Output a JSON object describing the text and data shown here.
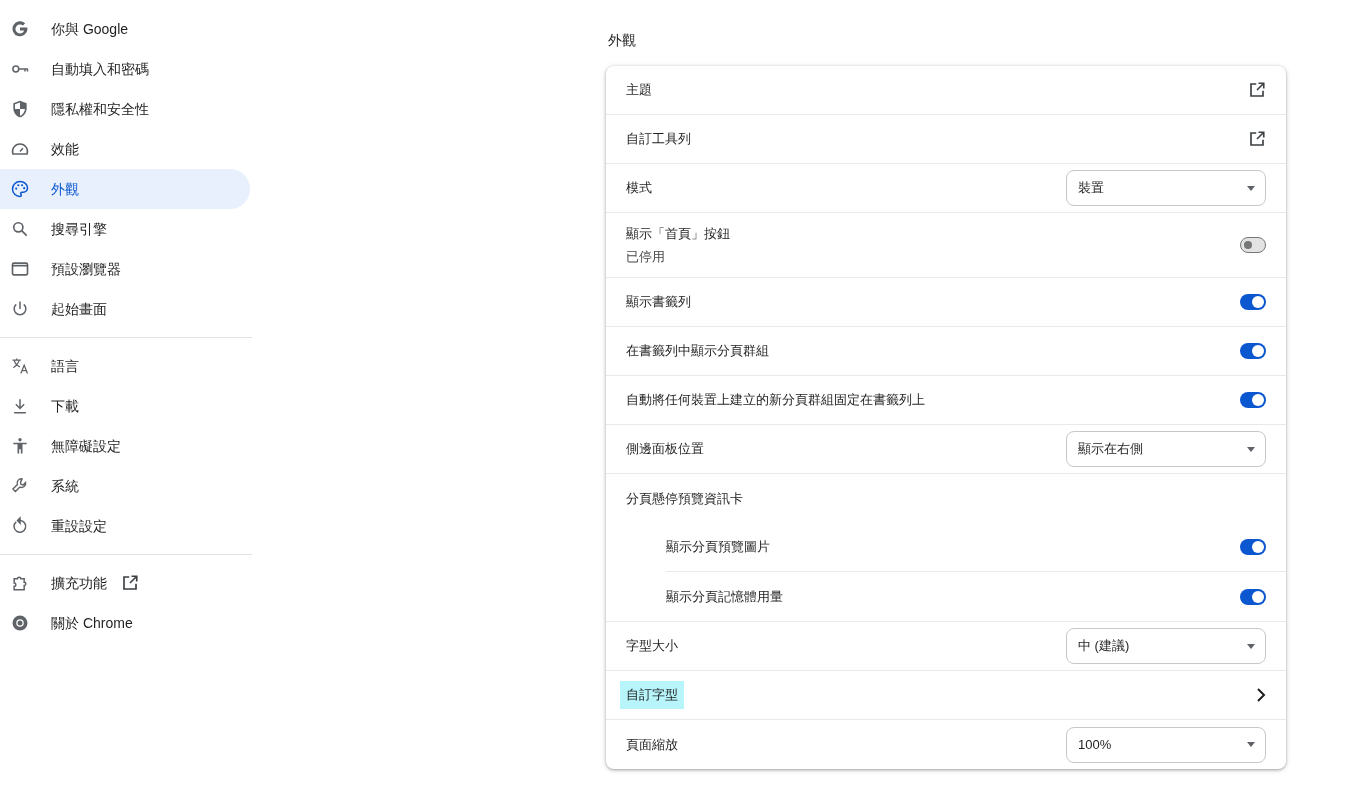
{
  "sidebar": {
    "groups": [
      [
        {
          "label": "你與 Google",
          "selected": false
        },
        {
          "label": "自動填入和密碼",
          "selected": false
        },
        {
          "label": "隱私權和安全性",
          "selected": false
        },
        {
          "label": "效能",
          "selected": false
        },
        {
          "label": "外觀",
          "selected": true
        },
        {
          "label": "搜尋引擎",
          "selected": false
        },
        {
          "label": "預設瀏覽器",
          "selected": false
        },
        {
          "label": "起始畫面",
          "selected": false
        }
      ],
      [
        {
          "label": "語言",
          "selected": false
        },
        {
          "label": "下載",
          "selected": false
        },
        {
          "label": "無障礙設定",
          "selected": false
        },
        {
          "label": "系統",
          "selected": false
        },
        {
          "label": "重設設定",
          "selected": false
        }
      ],
      [
        {
          "label": "擴充功能",
          "selected": false,
          "external": true
        },
        {
          "label": "關於 Chrome",
          "selected": false
        }
      ]
    ]
  },
  "section": {
    "title": "外觀",
    "rows": [
      {
        "kind": "link",
        "label": "主題"
      },
      {
        "kind": "link",
        "label": "自訂工具列"
      },
      {
        "kind": "select",
        "label": "模式",
        "value": "裝置"
      },
      {
        "kind": "toggle",
        "label": "顯示「首頁」按鈕",
        "sublabel": "已停用",
        "on": false
      },
      {
        "kind": "toggle",
        "label": "顯示書籤列",
        "on": true
      },
      {
        "kind": "toggle",
        "label": "在書籤列中顯示分頁群組",
        "on": true
      },
      {
        "kind": "toggle",
        "label": "自動將任何裝置上建立的新分頁群組固定在書籤列上",
        "on": true
      },
      {
        "kind": "select",
        "label": "側邊面板位置",
        "value": "顯示在右側"
      },
      {
        "kind": "heading",
        "label": "分頁懸停預覽資訊卡",
        "children": [
          {
            "kind": "toggle",
            "label": "顯示分頁預覽圖片",
            "on": true
          },
          {
            "kind": "toggle",
            "label": "顯示分頁記憶體用量",
            "on": true
          }
        ]
      },
      {
        "kind": "select",
        "label": "字型大小",
        "value": "中 (建議)"
      },
      {
        "kind": "chevron",
        "label": "自訂字型",
        "highlighted": true
      },
      {
        "kind": "select",
        "label": "頁面縮放",
        "value": "100%"
      }
    ]
  }
}
